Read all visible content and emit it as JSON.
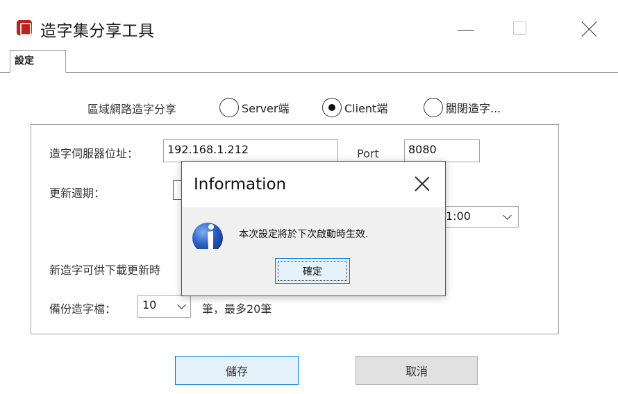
{
  "window": {
    "title": "造字集分享工具",
    "icon": "app-seal-icon"
  },
  "tabs": [
    {
      "label": "設定",
      "active": true
    }
  ],
  "settings": {
    "share_label": "區域網路造字分享",
    "radio_options": [
      {
        "label": "Server端",
        "checked": false
      },
      {
        "label": "Client端",
        "checked": true
      },
      {
        "label": "關閉造字...",
        "checked": false
      }
    ],
    "server_address_label": "造字伺服器位址：",
    "server_address_value": "192.168.1.212",
    "port_label": "Port",
    "port_value": "8080",
    "update_period_label": "更新週期：",
    "update_time_value": "1:00",
    "download_label_partial": "新造字可供下載更新時",
    "backup_label": "備份造字檔：",
    "backup_count_value": "10",
    "backup_suffix": "筆，最多20筆"
  },
  "buttons": {
    "save": "儲存",
    "cancel": "取消"
  },
  "dialog": {
    "title": "Information",
    "message": "本次設定將於下次啟動時生效.",
    "ok_label": "確定",
    "icon": "info-icon"
  }
}
